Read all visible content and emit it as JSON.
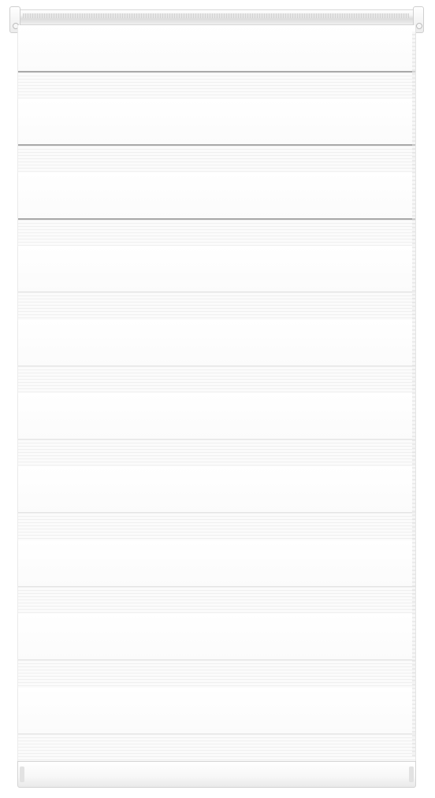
{
  "scene": {
    "subject": "double-roller-blind",
    "colors": {
      "fabric": "#ffffff",
      "sheer_stripe": "#fbfbfb",
      "top_dark_line": "#a9a9a9",
      "rail": "#f4f4f4"
    },
    "band_count": 10
  }
}
